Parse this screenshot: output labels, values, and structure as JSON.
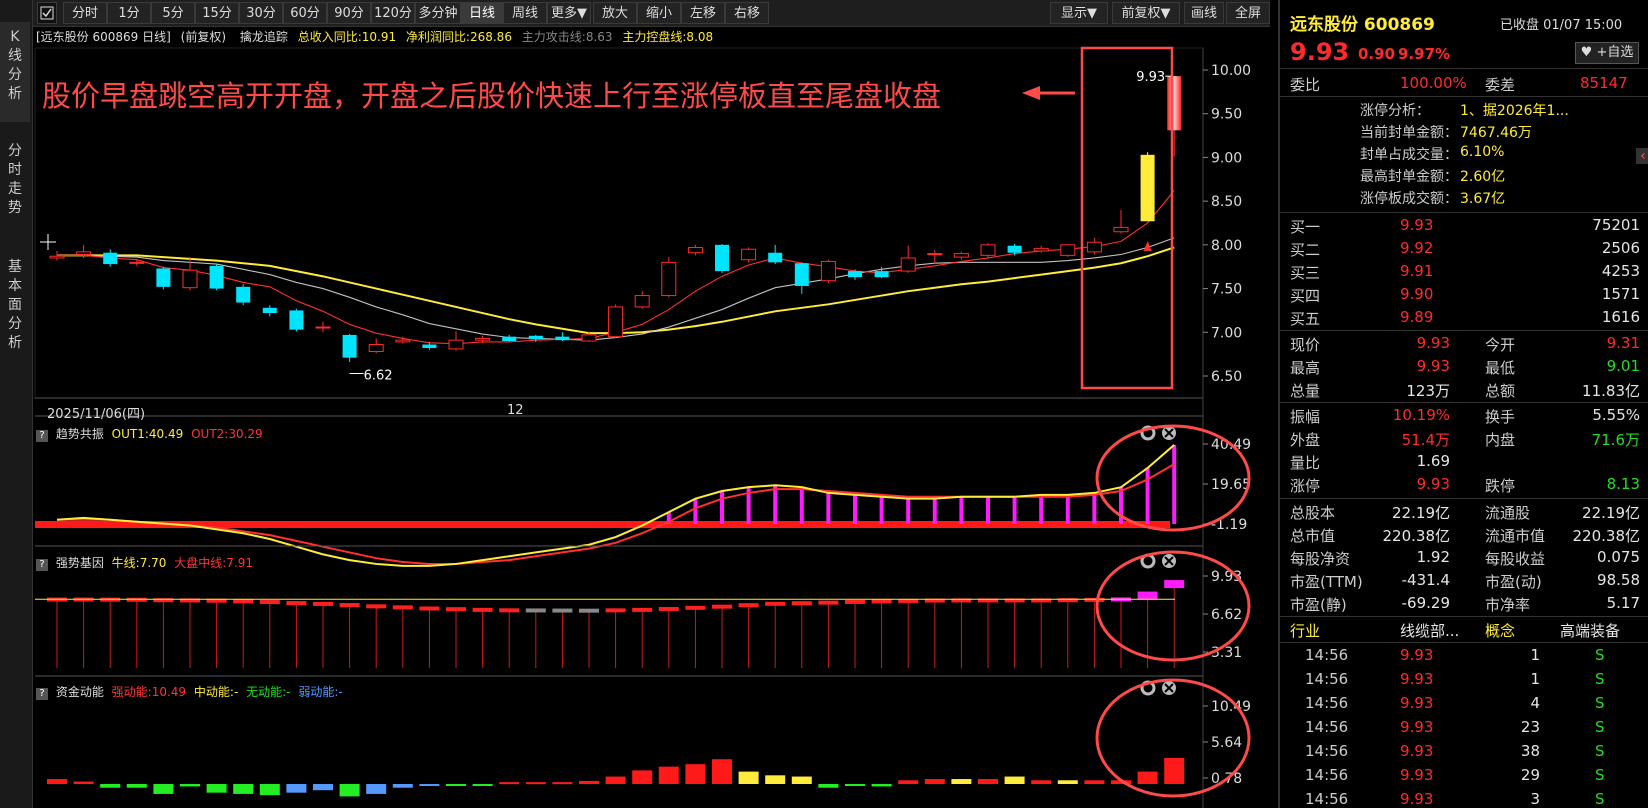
{
  "colors": {
    "up": "#ff2b2b",
    "down": "#00e5ff",
    "yellow": "#ffeb3b",
    "ma": "#c0c0c0",
    "accent": "#ff4040"
  },
  "toolbar": {
    "periods": [
      "分时",
      "1分",
      "5分",
      "15分",
      "30分",
      "60分",
      "90分",
      "120分",
      "多分钟",
      "日线",
      "周线",
      "更多▼"
    ],
    "actions": [
      "放大",
      "缩小",
      "左移",
      "右移"
    ],
    "right": [
      "显示▼",
      "前复权▼",
      "画线",
      "全屏"
    ],
    "active": "日线"
  },
  "side_tabs": [
    {
      "label": "K线分析",
      "icon": ""
    },
    {
      "label": "分时走势"
    },
    {
      "label": "基本面分析"
    }
  ],
  "chart_header": {
    "stock": "[远东股份 600869 日线]",
    "adjust": "(前复权)",
    "indicator": "擒龙追踪",
    "rev": "总收入同比:10.91",
    "profit": "净利润同比:268.86",
    "attack": "主力攻击线:8.63",
    "control": "主力控盘线:8.08"
  },
  "annotation": "股价早盘跳空高开开盘，开盘之后股价快速上行至涨停板直至尾盘收盘",
  "main_axis": {
    "ticks": [
      "10.00",
      "9.50",
      "9.00",
      "8.50",
      "8.00",
      "7.50",
      "7.00",
      "6.50"
    ]
  },
  "date_labels": [
    "2025/11/06(四)",
    "12"
  ],
  "high_label": "9.93",
  "low_label": "6.62",
  "panel1": {
    "name": "趋势共振",
    "out1": "OUT1:40.49",
    "out2": "OUT2:30.29",
    "ticks": [
      "40.49",
      "19.65",
      "-1.19"
    ]
  },
  "panel2": {
    "name": "强势基因",
    "bull": "牛线:7.70",
    "market": "大盘中线:7.91",
    "ticks": [
      "9.93",
      "6.62",
      "3.31"
    ]
  },
  "panel3": {
    "name": "资金动能",
    "strong": "强动能:10.49",
    "mid": "中动能:-",
    "none": "无动能:-",
    "weak": "弱动能:-",
    "ticks": [
      "10.49",
      "5.64",
      "0.78"
    ]
  },
  "chart_data": {
    "type": "candlestick",
    "ylim": [
      6.5,
      10.0
    ],
    "candles": [
      [
        7.85,
        7.87,
        7.93,
        7.82
      ],
      [
        7.89,
        7.92,
        8.0,
        7.85
      ],
      [
        7.91,
        7.78,
        7.95,
        7.75
      ],
      [
        7.79,
        7.8,
        7.84,
        7.76
      ],
      [
        7.73,
        7.52,
        7.75,
        7.49
      ],
      [
        7.51,
        7.71,
        7.86,
        7.48
      ],
      [
        7.76,
        7.5,
        7.78,
        7.48
      ],
      [
        7.52,
        7.34,
        7.55,
        7.31
      ],
      [
        7.28,
        7.22,
        7.31,
        7.18
      ],
      [
        7.25,
        7.03,
        7.27,
        7.01
      ],
      [
        7.05,
        7.06,
        7.12,
        7.0
      ],
      [
        6.97,
        6.71,
        6.98,
        6.66
      ],
      [
        6.78,
        6.86,
        6.93,
        6.76
      ],
      [
        6.89,
        6.91,
        6.95,
        6.87
      ],
      [
        6.86,
        6.82,
        6.89,
        6.8
      ],
      [
        6.81,
        6.91,
        7.01,
        6.79
      ],
      [
        6.91,
        6.93,
        6.96,
        6.88
      ],
      [
        6.95,
        6.9,
        6.97,
        6.89
      ],
      [
        6.96,
        6.92,
        6.97,
        6.89
      ],
      [
        6.95,
        6.91,
        7.0,
        6.9
      ],
      [
        6.9,
        6.97,
        7.01,
        6.89
      ],
      [
        6.95,
        7.29,
        7.32,
        6.93
      ],
      [
        7.29,
        7.42,
        7.47,
        7.27
      ],
      [
        7.42,
        7.8,
        7.86,
        7.4
      ],
      [
        7.91,
        7.97,
        8.0,
        7.88
      ],
      [
        8.0,
        7.7,
        8.01,
        7.68
      ],
      [
        7.83,
        7.95,
        7.97,
        7.8
      ],
      [
        7.91,
        7.8,
        8.0,
        7.78
      ],
      [
        7.79,
        7.53,
        7.8,
        7.44
      ],
      [
        7.59,
        7.81,
        7.83,
        7.56
      ],
      [
        7.7,
        7.63,
        7.72,
        7.6
      ],
      [
        7.7,
        7.63,
        7.75,
        7.62
      ],
      [
        7.7,
        7.85,
        7.99,
        7.68
      ],
      [
        7.89,
        7.9,
        7.94,
        7.78
      ],
      [
        7.86,
        7.9,
        7.92,
        7.83
      ],
      [
        7.88,
        8.0,
        8.02,
        7.85
      ],
      [
        7.99,
        7.91,
        8.01,
        7.88
      ],
      [
        7.93,
        7.96,
        7.99,
        7.91
      ],
      [
        7.88,
        8.0,
        8.01,
        7.86
      ],
      [
        7.92,
        8.03,
        8.08,
        7.89
      ],
      [
        8.15,
        8.2,
        8.4,
        8.13
      ],
      [
        8.27,
        9.03,
        9.06,
        8.27
      ],
      [
        9.31,
        9.93,
        9.93,
        9.01
      ]
    ],
    "ma5": [
      7.88,
      7.88,
      7.85,
      7.83,
      7.74,
      7.71,
      7.65,
      7.57,
      7.52,
      7.36,
      7.24,
      7.09,
      6.99,
      6.93,
      6.88,
      6.87,
      6.89,
      6.89,
      6.91,
      6.92,
      6.93,
      7.0,
      7.09,
      7.26,
      7.47,
      7.64,
      7.77,
      7.85,
      7.79,
      7.75,
      7.7,
      7.68,
      7.72,
      7.76,
      7.81,
      7.85,
      7.9,
      7.93,
      7.95,
      7.98,
      8.04,
      8.25,
      8.62
    ],
    "ma10": [
      7.88,
      7.88,
      7.87,
      7.86,
      7.82,
      7.8,
      7.78,
      7.72,
      7.66,
      7.57,
      7.5,
      7.4,
      7.29,
      7.2,
      7.1,
      7.04,
      6.98,
      6.94,
      6.93,
      6.92,
      6.91,
      6.94,
      6.98,
      7.06,
      7.16,
      7.26,
      7.39,
      7.51,
      7.56,
      7.61,
      7.67,
      7.72,
      7.76,
      7.79,
      7.8,
      7.8,
      7.8,
      7.8,
      7.82,
      7.85,
      7.89,
      7.97,
      8.08
    ],
    "ma20": [
      7.88,
      7.88,
      7.88,
      7.88,
      7.86,
      7.84,
      7.82,
      7.79,
      7.76,
      7.7,
      7.64,
      7.57,
      7.5,
      7.43,
      7.36,
      7.29,
      7.22,
      7.15,
      7.09,
      7.04,
      6.99,
      6.99,
      7.0,
      7.03,
      7.07,
      7.12,
      7.18,
      7.24,
      7.28,
      7.32,
      7.37,
      7.42,
      7.47,
      7.51,
      7.55,
      7.58,
      7.62,
      7.66,
      7.7,
      7.74,
      7.79,
      7.87,
      7.97
    ],
    "trend_out1": [
      1,
      2,
      1,
      0,
      -1,
      -2,
      -4,
      -6,
      -9,
      -13,
      -17,
      -20,
      -22,
      -23,
      -23,
      -22,
      -20,
      -18,
      -16,
      -14,
      -12,
      -8,
      -2,
      5,
      12,
      16,
      18,
      19,
      18,
      15,
      14,
      13,
      12,
      12,
      13,
      13,
      13,
      14,
      14,
      15,
      18,
      28,
      40
    ],
    "trend_out2": [
      1,
      1,
      1,
      0,
      -1,
      -2,
      -3,
      -5,
      -7,
      -10,
      -13,
      -16,
      -19,
      -21,
      -22,
      -22,
      -21,
      -20,
      -18,
      -16,
      -14,
      -11,
      -6,
      0,
      7,
      12,
      15,
      17,
      17,
      16,
      15,
      14,
      13,
      13,
      13,
      13,
      13,
      13,
      13,
      14,
      16,
      22,
      30
    ],
    "gene_values": [
      7.88,
      7.88,
      7.87,
      7.86,
      7.82,
      7.8,
      7.78,
      7.72,
      7.66,
      7.57,
      7.5,
      7.4,
      7.29,
      7.2,
      7.1,
      7.04,
      6.98,
      6.94,
      6.93,
      6.92,
      6.91,
      6.94,
      6.98,
      7.06,
      7.16,
      7.26,
      7.39,
      7.51,
      7.56,
      7.61,
      7.67,
      7.72,
      7.76,
      7.79,
      7.8,
      7.8,
      7.8,
      7.8,
      7.82,
      7.85,
      7.89,
      8.4,
      9.4
    ],
    "fund_values": [
      0.8,
      0.4,
      -0.6,
      -0.6,
      -1.6,
      -0.4,
      -1.4,
      -1.6,
      -1.8,
      -1.4,
      -1.0,
      -2.0,
      -1.6,
      -0.6,
      -0.3,
      -0.2,
      -0.1,
      0.3,
      0.3,
      0.3,
      0.5,
      1.2,
      2.2,
      2.8,
      3.2,
      4.0,
      2.0,
      1.4,
      1.2,
      -0.6,
      -0.2,
      -0.4,
      0.6,
      0.8,
      0.8,
      0.8,
      1.2,
      0.6,
      0.6,
      0.6,
      0.6,
      2.0,
      4.2,
      10.49
    ]
  },
  "quote": {
    "name": "远东股份",
    "code": "600869",
    "status": "已收盘 01/07 15:00",
    "price": "9.93",
    "chg": "0.90",
    "pct": "9.97%",
    "watch": "+自选",
    "weibi_label": "委比",
    "weibi": "100.00%",
    "weicha_label": "委差",
    "weicha": "85147",
    "zt": [
      {
        "k": "涨停分析：",
        "v": "1、据2026年1..."
      },
      {
        "k": "当前封单金额：",
        "v": "7467.46万"
      },
      {
        "k": "封单占成交量：",
        "v": "6.10%"
      },
      {
        "k": "最高封单金额：",
        "v": "2.60亿"
      },
      {
        "k": "涨停板成交额：",
        "v": "3.67亿"
      }
    ],
    "bids": [
      {
        "label": "买一",
        "price": "9.93",
        "vol": "75201"
      },
      {
        "label": "买二",
        "price": "9.92",
        "vol": "2506"
      },
      {
        "label": "买三",
        "price": "9.91",
        "vol": "4253"
      },
      {
        "label": "买四",
        "price": "9.90",
        "vol": "1571"
      },
      {
        "label": "买五",
        "price": "9.89",
        "vol": "1616"
      }
    ],
    "stats": [
      [
        {
          "k": "现价",
          "v": "9.93",
          "c": "red"
        },
        {
          "k": "今开",
          "v": "9.31",
          "c": "red"
        }
      ],
      [
        {
          "k": "最高",
          "v": "9.93",
          "c": "red"
        },
        {
          "k": "最低",
          "v": "9.01",
          "c": "green"
        }
      ],
      [
        {
          "k": "总量",
          "v": "123万",
          "c": "white"
        },
        {
          "k": "总额",
          "v": "11.83亿",
          "c": "white"
        }
      ]
    ],
    "stats2": [
      [
        {
          "k": "振幅",
          "v": "10.19%",
          "c": "red"
        },
        {
          "k": "换手",
          "v": "5.55%",
          "c": "white"
        }
      ],
      [
        {
          "k": "外盘",
          "v": "51.4万",
          "c": "red"
        },
        {
          "k": "内盘",
          "v": "71.6万",
          "c": "green"
        }
      ],
      [
        {
          "k": "量比",
          "v": "1.69",
          "c": "white"
        },
        {
          "k": "",
          "v": "",
          "c": "white"
        }
      ],
      [
        {
          "k": "涨停",
          "v": "9.93",
          "c": "red"
        },
        {
          "k": "跌停",
          "v": "8.13",
          "c": "green"
        }
      ]
    ],
    "stats3": [
      [
        {
          "k": "总股本",
          "v": "22.19亿"
        },
        {
          "k": "流通股",
          "v": "22.19亿"
        }
      ],
      [
        {
          "k": "总市值",
          "v": "220.38亿"
        },
        {
          "k": "流通市值",
          "v": "220.38亿"
        }
      ],
      [
        {
          "k": "每股净资",
          "v": "1.92"
        },
        {
          "k": "每股收益",
          "v": "0.075"
        }
      ],
      [
        {
          "k": "市盈(TTM)",
          "v": "-431.4"
        },
        {
          "k": "市盈(动)",
          "v": "98.58"
        }
      ],
      [
        {
          "k": "市盈(静)",
          "v": "-69.29"
        },
        {
          "k": "市净率",
          "v": "5.17"
        }
      ]
    ],
    "industry": {
      "k1": "行业",
      "v1": "线缆部...",
      "k2": "概念",
      "v2": "高端装备"
    },
    "ticks": [
      {
        "t": "14:56",
        "p": "9.93",
        "v": "1",
        "s": "S"
      },
      {
        "t": "14:56",
        "p": "9.93",
        "v": "1",
        "s": "S"
      },
      {
        "t": "14:56",
        "p": "9.93",
        "v": "4",
        "s": "S"
      },
      {
        "t": "14:56",
        "p": "9.93",
        "v": "23",
        "s": "S"
      },
      {
        "t": "14:56",
        "p": "9.93",
        "v": "38",
        "s": "S"
      },
      {
        "t": "14:56",
        "p": "9.93",
        "v": "29",
        "s": "S"
      },
      {
        "t": "14:56",
        "p": "9.93",
        "v": "3",
        "s": "S"
      }
    ]
  }
}
